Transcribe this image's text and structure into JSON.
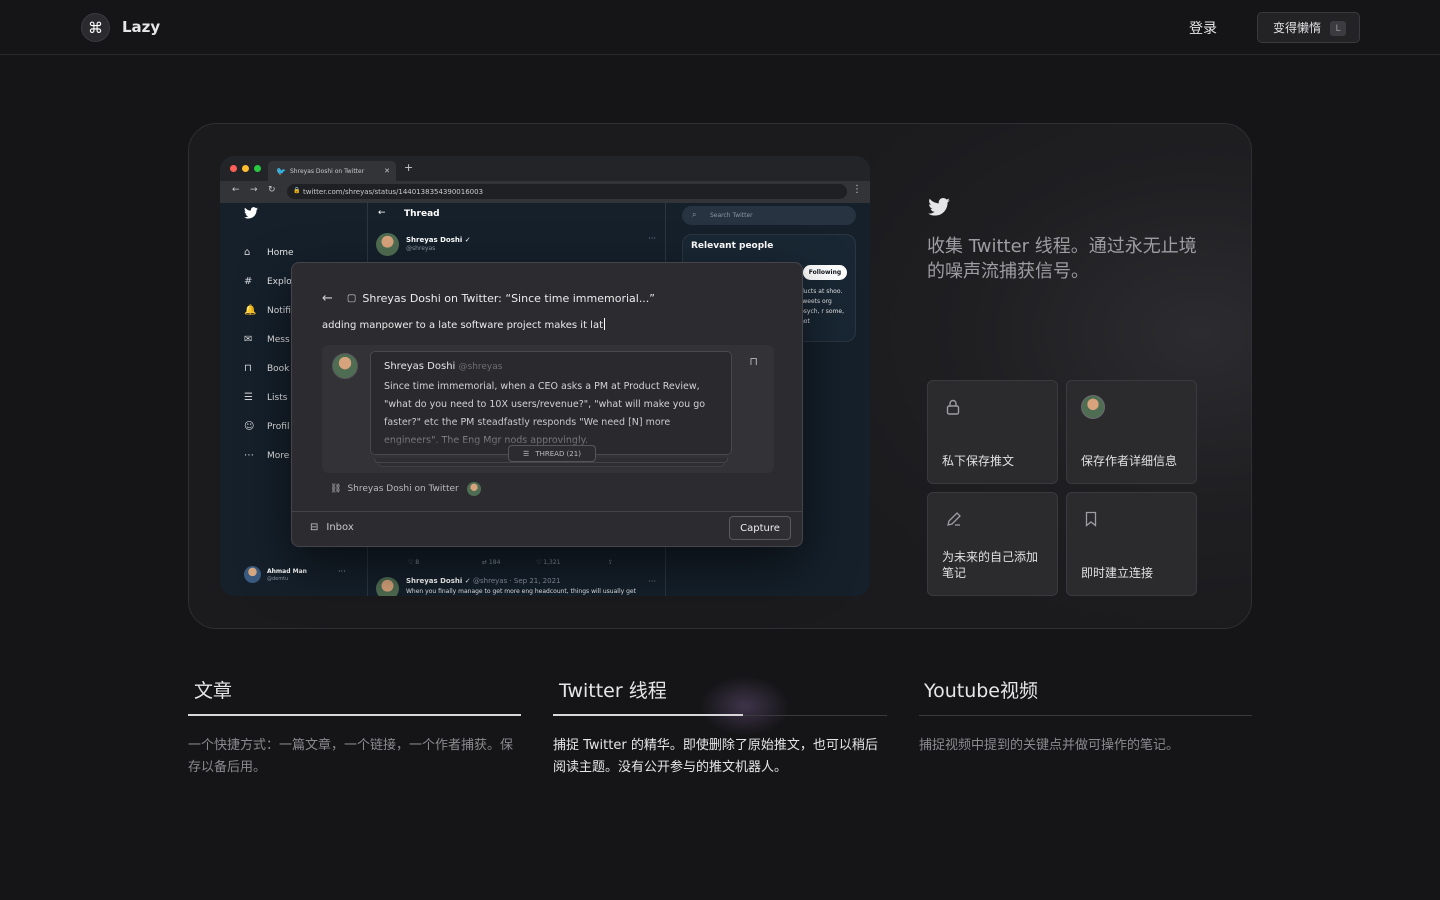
{
  "nav": {
    "brand": "Lazy",
    "logo_icon": "⌘",
    "login": "登录",
    "cta": "变得懒惰",
    "cta_key": "L"
  },
  "browser": {
    "tab_title": "Shreyas Doshi on Twitter",
    "url": "twitter.com/shreyas/status/1440138354390016003"
  },
  "twitter": {
    "side_items": [
      {
        "icon": "⌂",
        "label": "Home"
      },
      {
        "icon": "#",
        "label": "Explo"
      },
      {
        "icon": "🔔",
        "label": "Notifi"
      },
      {
        "icon": "✉",
        "label": "Mess"
      },
      {
        "icon": "⊓",
        "label": "Book"
      },
      {
        "icon": "☰",
        "label": "Lists"
      },
      {
        "icon": "☺",
        "label": "Profil"
      },
      {
        "icon": "⋯",
        "label": "More"
      }
    ],
    "me_name": "Ahmad Man",
    "me_handle": "@demtu",
    "thread_title": "Thread",
    "author_name": "Shreyas Doshi ✓",
    "author_handle": "@shreyas",
    "stats": [
      "♡ 8",
      "⇄ 184",
      "♡ 1,321",
      "⇪"
    ],
    "post2_name": "Shreyas Doshi ✓",
    "post2_meta": "@shreyas · Sep 21, 2021",
    "post2_text": "When you finally manage to get more eng headcount, things will usually get",
    "search_placeholder": "Search Twitter",
    "relevant_title": "Relevant people",
    "follow": "Following",
    "bio": "ducts at shoo. tweets org psych, r some, not"
  },
  "modal": {
    "title": "Shreyas Doshi on Twitter: “Since time immemorial...”",
    "input": "adding manpower to a late software project makes it lat",
    "tweet_name": "Shreyas Doshi",
    "tweet_handle": "@shreyas",
    "tweet_text": "Since time immemorial, when a CEO asks a PM at Product Review, \"what do you need to 10X users/revenue?\", \"what will make you go faster?\" etc the PM steadfastly responds \"We need [N] more engineers\". The Eng Mgr nods approvingly.",
    "thread_pill": "THREAD (21)",
    "source": "Shreyas Doshi on Twitter",
    "inbox": "Inbox",
    "capture": "Capture"
  },
  "card": {
    "headline": "收集 Twitter 线程。通过永无止境的噪声流捕获信号。",
    "features": [
      {
        "icon": "lock-icon",
        "label": "私下保存推文"
      },
      {
        "icon": "avatar-icon",
        "label": "保存作者详细信息"
      },
      {
        "icon": "pencil-icon",
        "label": "为未来的自己添加笔记"
      },
      {
        "icon": "bookmark-icon",
        "label": "即时建立连接"
      }
    ]
  },
  "tabs": [
    {
      "title": "文章",
      "desc": "一个快捷方式：一篇文章，一个链接，一个作者捕获。保存以备后用。",
      "progress": 1.0,
      "active": false
    },
    {
      "title": "Twitter 线程",
      "desc": "捕捉 Twitter 的精华。即使删除了原始推文，也可以稍后阅读主题。没有公开参与的推文机器人。",
      "progress": 0.57,
      "active": true
    },
    {
      "title": "Youtube视频",
      "desc": "捕捉视频中提到的关键点并做可操作的笔记。",
      "progress": 0,
      "active": false
    }
  ],
  "colors": {
    "accent_glow": "#8c6eaa",
    "twitter_bg": "#15202b",
    "twitter_blue": "#1d9bf0"
  }
}
